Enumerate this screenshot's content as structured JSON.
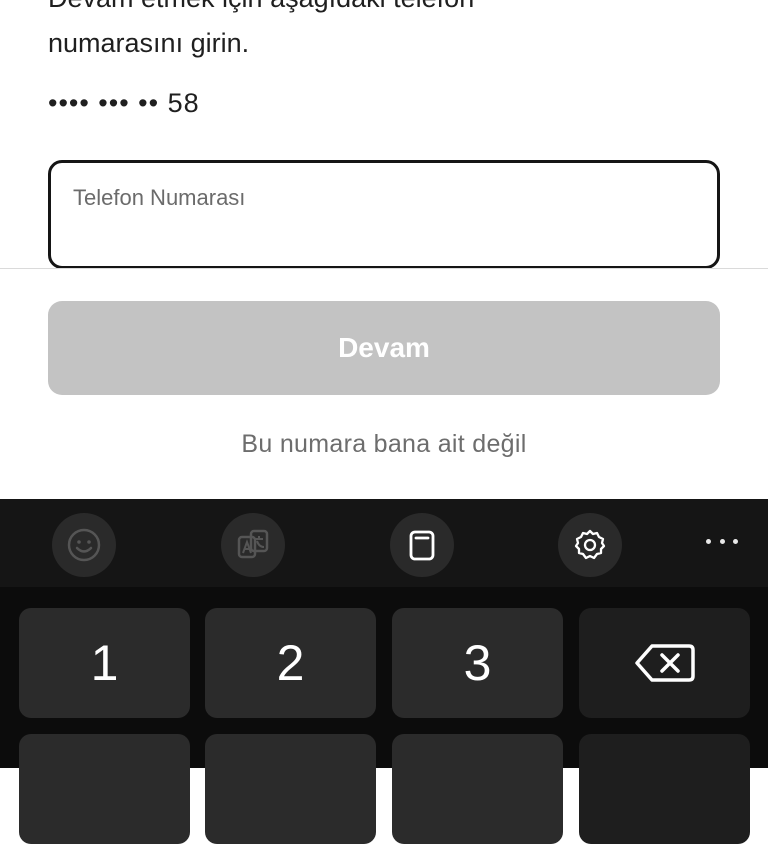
{
  "instruction": {
    "text": "Devam etmek için aşağıdaki telefon\nnumarasını girin."
  },
  "masked_number": "•••• ••• •• 58",
  "phone_field": {
    "label": "Telefon Numarası",
    "value": ""
  },
  "continue_button": {
    "label": "Devam",
    "enabled": false,
    "color": "#c3c3c3"
  },
  "not_mine_link": "Bu numara bana ait değil",
  "keyboard": {
    "toolbar": [
      "emoji-icon",
      "translate-icon",
      "clipboard-icon",
      "settings-icon",
      "more-icon"
    ],
    "keys_row1": [
      "1",
      "2",
      "3"
    ],
    "backspace_icon": "backspace-icon"
  }
}
